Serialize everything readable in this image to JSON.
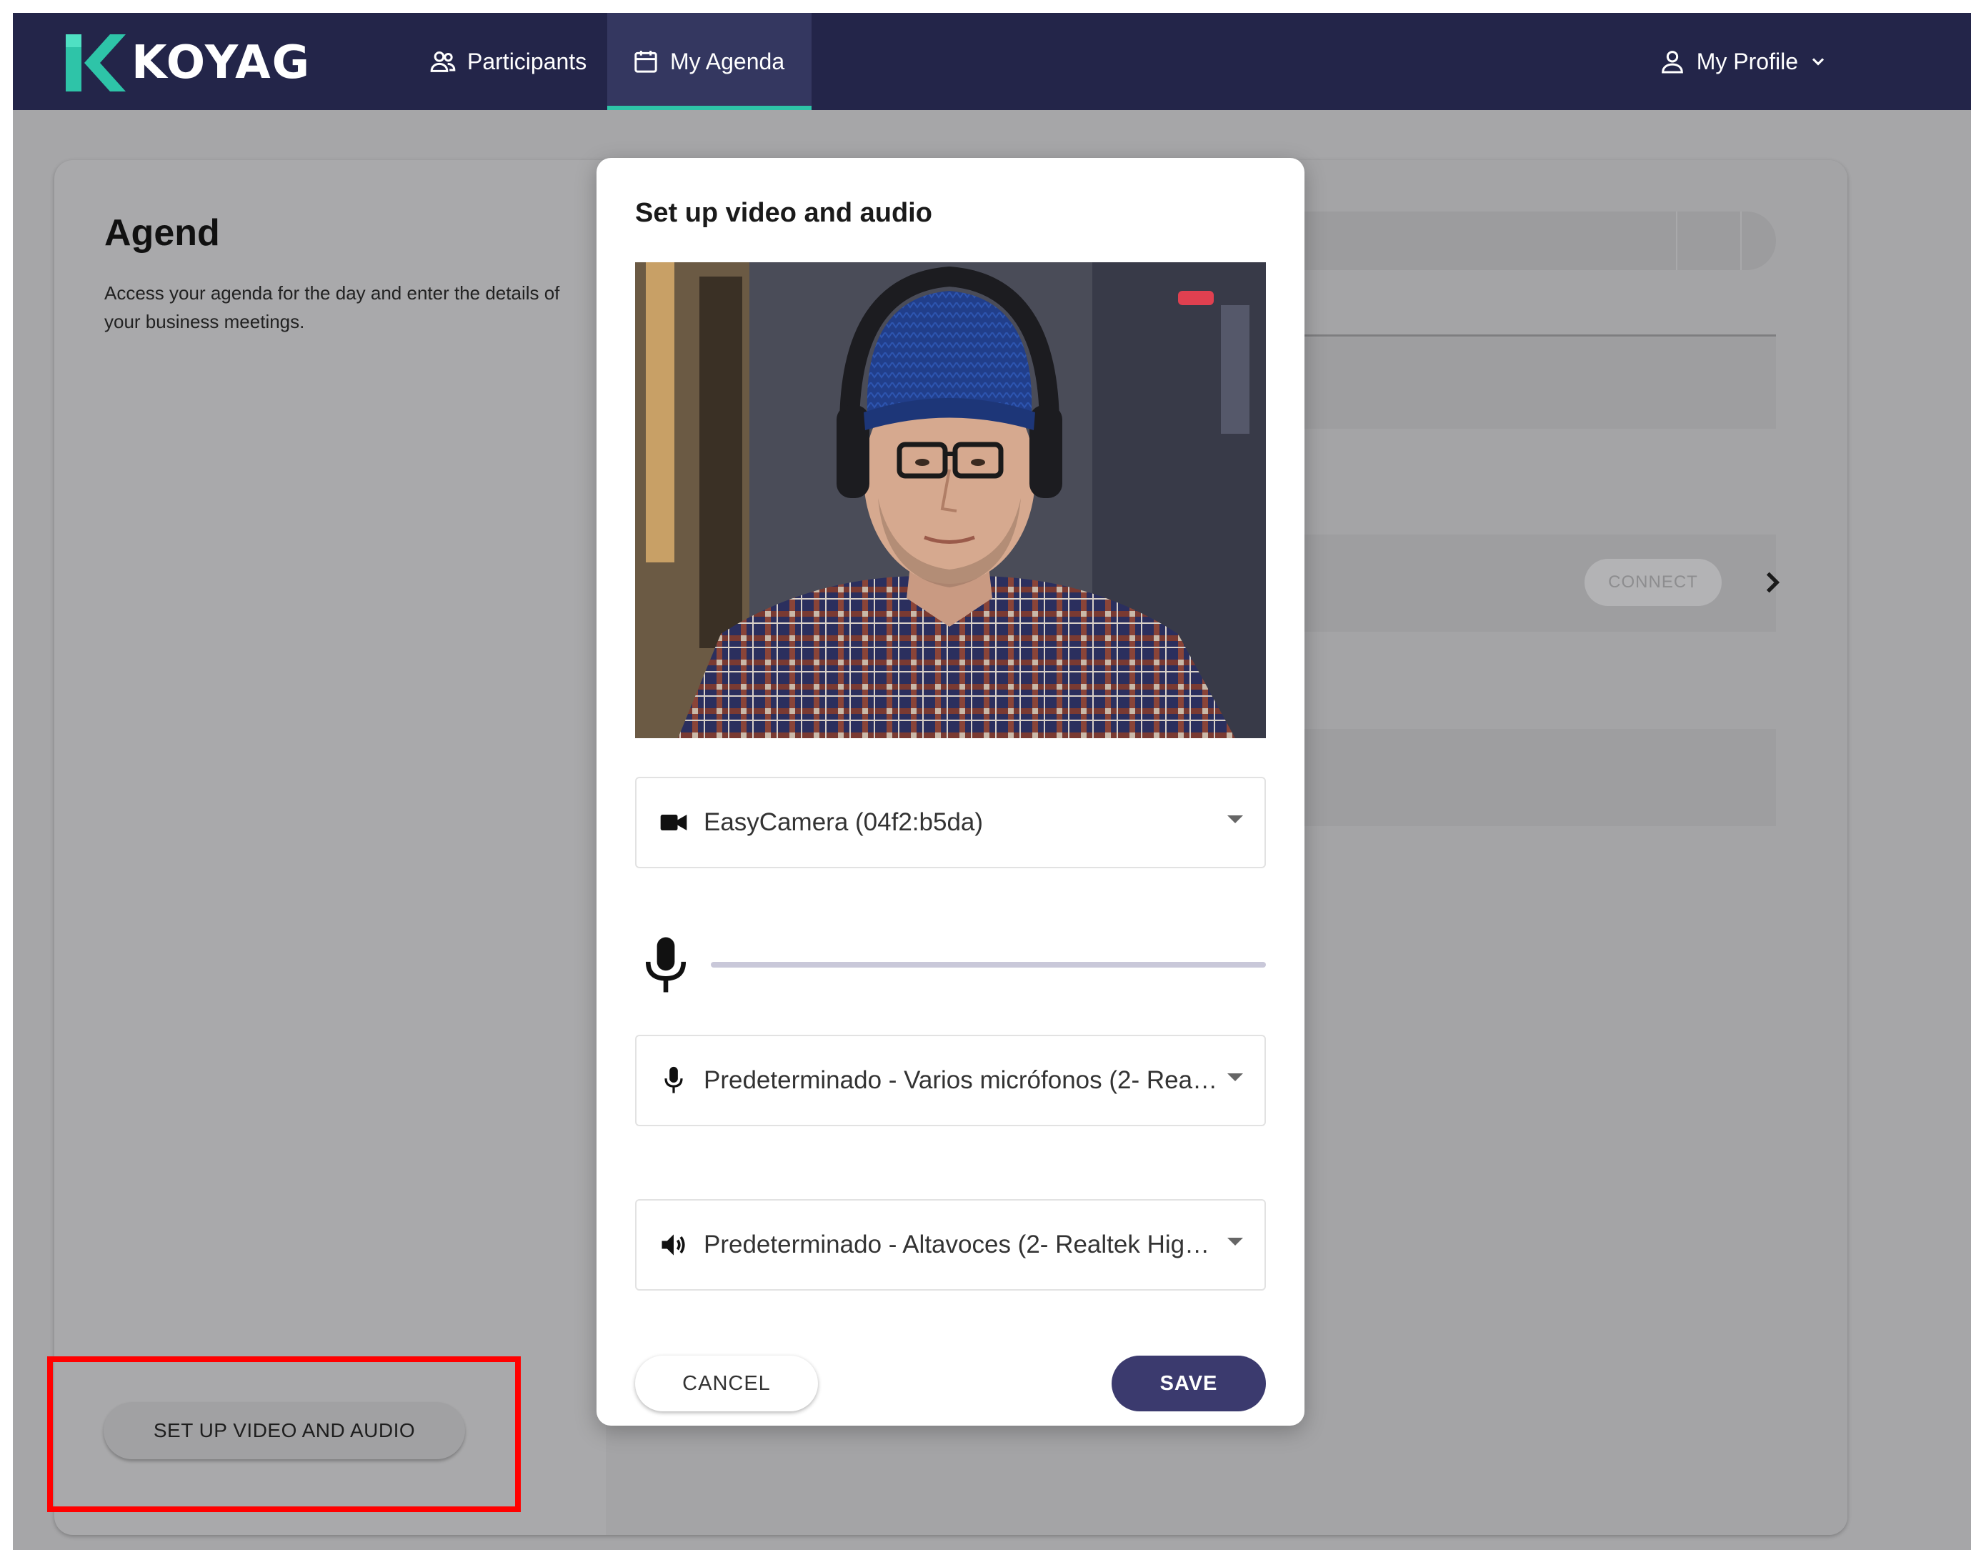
{
  "header": {
    "logo_text": "KOYAG",
    "nav": {
      "participants": "Participants",
      "agenda": "My Agenda",
      "profile": "My Profile"
    }
  },
  "agenda": {
    "title": "Agend",
    "description": "Access your agenda for the day and enter the details of your business meetings.",
    "setup_button": "SET UP VIDEO AND AUDIO",
    "connect_button": "CONNECT"
  },
  "dialog": {
    "title": "Set up video and audio",
    "camera_select": "EasyCamera (04f2:b5da)",
    "microphone_select": "Predeterminado - Varios micrófonos (2- Real...",
    "speaker_select": "Predeterminado - Altavoces (2- Realtek High...",
    "mic_level": 0,
    "cancel_label": "CANCEL",
    "save_label": "SAVE"
  },
  "colors": {
    "topbar": "#232549",
    "accent_underline": "#2ec4a8",
    "save_button": "#3b3a6e",
    "highlight": "#ff0000"
  },
  "icons": {
    "participants": "people-icon",
    "agenda": "calendar-icon",
    "profile": "person-icon",
    "camera": "videocam-icon",
    "microphone": "mic-icon",
    "speaker": "volume-icon"
  }
}
